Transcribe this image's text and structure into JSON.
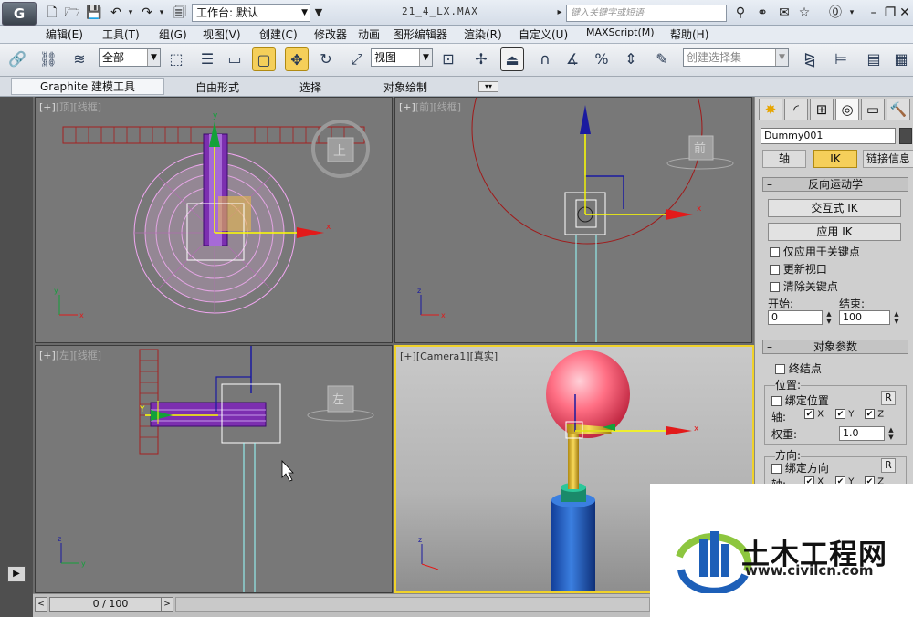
{
  "app": {
    "logo_text": "G",
    "workspace_label": "工作台: 默认",
    "doc_title": "21_4_LX.MAX",
    "search_placeholder": "键入关键字或短语"
  },
  "menu": [
    "编辑(E)",
    "工具(T)",
    "组(G)",
    "视图(V)",
    "创建(C)",
    "修改器",
    "动画",
    "图形编辑器",
    "渲染(R)",
    "自定义(U)",
    "MAXScript(M)",
    "帮助(H)"
  ],
  "toolbar": {
    "filter_value": "全部",
    "ref_coord_value": "视图",
    "selection_set_placeholder": "创建选择集"
  },
  "ribbon": {
    "tabs": [
      "Graphite 建模工具",
      "自由形式",
      "选择",
      "对象绘制"
    ]
  },
  "viewports": {
    "top": {
      "plus": "[+]",
      "name": "[顶]",
      "shade": "[线框]",
      "cube_label": "上"
    },
    "front": {
      "plus": "[+]",
      "name": "[前]",
      "shade": "[线框]",
      "cube_label": "前"
    },
    "left": {
      "plus": "[+]",
      "name": "[左]",
      "shade": "[线框]",
      "cube_label": "左"
    },
    "camera": {
      "plus": "[+]",
      "name": "[Camera1]",
      "shade": "[真实]"
    }
  },
  "panel": {
    "object_name": "Dummy001",
    "subtabs": [
      "轴",
      "IK",
      "链接信息"
    ],
    "ik_rollout": {
      "title": "反向运动学",
      "interactive_ik": "交互式 IK",
      "apply_ik": "应用 IK",
      "only_keys": "仅应用于关键点",
      "update_viewport": "更新视口",
      "clear_keys": "清除关键点",
      "start_label": "开始:",
      "end_label": "结束:",
      "start_value": "0",
      "end_value": "100"
    },
    "object_params": {
      "title": "对象参数",
      "terminator": "终结点",
      "position_group": "位置:",
      "bind_position": "绑定位置",
      "axis_label": "轴:",
      "weight_label": "权重:",
      "weight_value": "1.0",
      "orientation_group": "方向:",
      "bind_orientation": "绑定方向",
      "r_button": "R",
      "axes": [
        "X",
        "Y",
        "Z"
      ]
    }
  },
  "timeline": {
    "frame": "0 / 100"
  },
  "watermark": {
    "title": "土木工程网",
    "url": "www.civilcn.com"
  }
}
